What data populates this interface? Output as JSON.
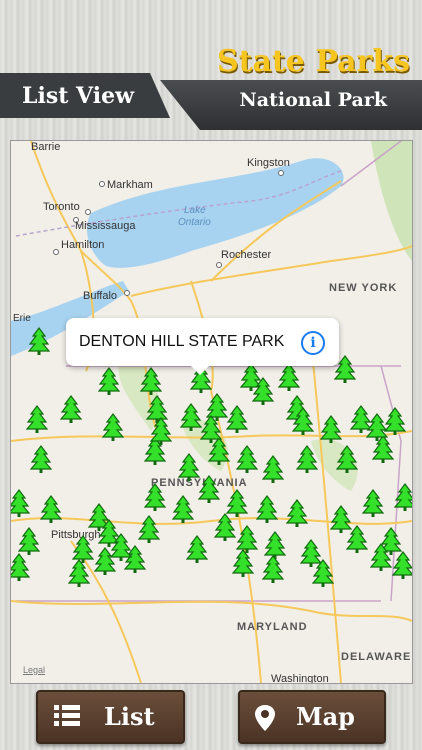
{
  "header": {
    "list_view_label": "List View",
    "title": "State Parks",
    "subtitle": "National Park"
  },
  "map": {
    "places": {
      "barrie": "Barrie",
      "kingston": "Kingston",
      "markham": "Markham",
      "toronto": "Toronto",
      "mississauga": "Mississauga",
      "hamilton": "Hamilton",
      "lake": "Lake",
      "ontario": "Ontario",
      "rochester": "Rochester",
      "buffalo": "Buffalo",
      "erie": "Erie",
      "new_york": "NEW YORK",
      "pennsylvania": "PENNSYLVANIA",
      "pittsburgh": "Pittsburgh",
      "maryland": "MARYLAND",
      "delaware": "DELAWARE",
      "washington": "Washington"
    },
    "callout_title": "DENTON HILL STATE PARK",
    "legal": "Legal",
    "pin_color": "#35e02a",
    "water_color": "#a8d3f0"
  },
  "buttons": {
    "list_label": "List",
    "map_label": "Map"
  }
}
